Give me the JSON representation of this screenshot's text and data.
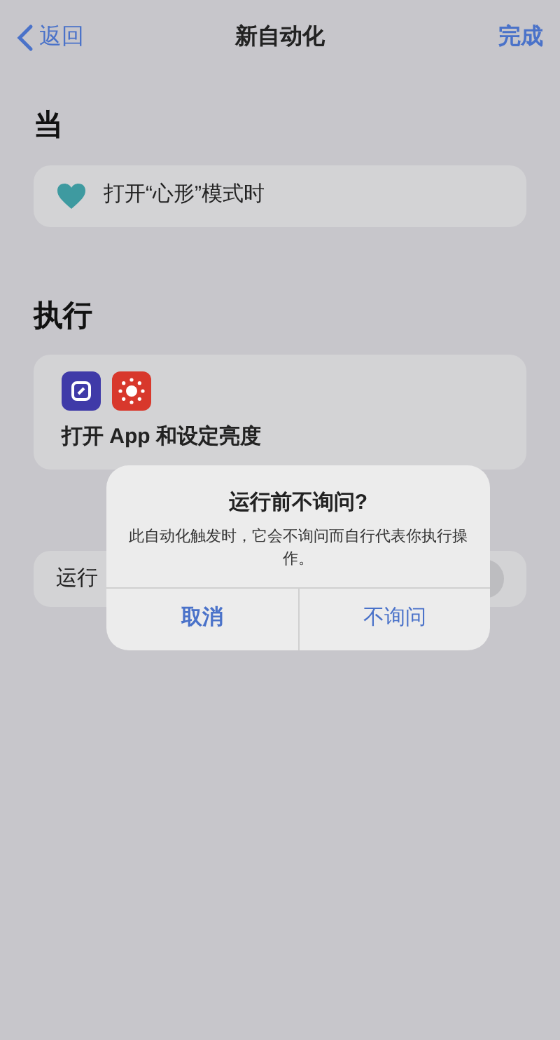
{
  "nav": {
    "back": "返回",
    "title": "新自动化",
    "done": "完成"
  },
  "when": {
    "heading": "当",
    "trigger": "打开“心形”模式时"
  },
  "do": {
    "heading": "执行",
    "actions": "打开 App 和设定亮度"
  },
  "ask_row": {
    "label": "运行",
    "on": false
  },
  "alert": {
    "title": "运行前不询问?",
    "message": "此自动化触发时，它会不询问而自行代表你执行操作。",
    "buttons": [
      {
        "label": "取消",
        "kind": "cancel"
      },
      {
        "label": "不询问",
        "kind": "confirm"
      }
    ]
  }
}
